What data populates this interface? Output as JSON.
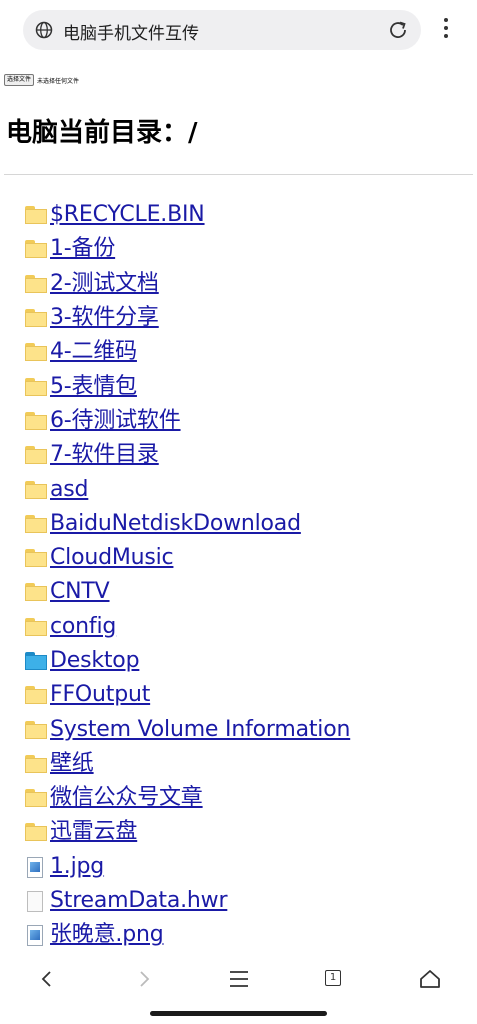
{
  "browser": {
    "url_title": "电脑手机文件互传",
    "tab_count": "1"
  },
  "upload": {
    "button_label": "选择文件",
    "no_file_text": "未选择任何文件"
  },
  "heading": "电脑当前目录：/",
  "entries": [
    {
      "name": "$RECYCLE.BIN",
      "type": "folder"
    },
    {
      "name": "1-备份",
      "type": "folder"
    },
    {
      "name": "2-测试文档",
      "type": "folder"
    },
    {
      "name": "3-软件分享",
      "type": "folder"
    },
    {
      "name": "4-二维码",
      "type": "folder"
    },
    {
      "name": "5-表情包",
      "type": "folder"
    },
    {
      "name": "6-待测试软件",
      "type": "folder"
    },
    {
      "name": "7-软件目录",
      "type": "folder"
    },
    {
      "name": "asd",
      "type": "folder"
    },
    {
      "name": "BaiduNetdiskDownload",
      "type": "folder"
    },
    {
      "name": "CloudMusic",
      "type": "folder"
    },
    {
      "name": "CNTV",
      "type": "folder"
    },
    {
      "name": "config",
      "type": "folder"
    },
    {
      "name": "Desktop",
      "type": "folder-blue"
    },
    {
      "name": "FFOutput",
      "type": "folder"
    },
    {
      "name": "System Volume Information",
      "type": "folder"
    },
    {
      "name": "壁纸",
      "type": "folder"
    },
    {
      "name": "微信公众号文章",
      "type": "folder"
    },
    {
      "name": "迅雷云盘",
      "type": "folder"
    },
    {
      "name": "1.jpg",
      "type": "image"
    },
    {
      "name": "StreamData.hwr",
      "type": "file"
    },
    {
      "name": "张晚意.png",
      "type": "image"
    }
  ],
  "colors": {
    "link": "#1a1aa6",
    "folder": "#fde38a",
    "folder_desktop": "#3db0e8"
  }
}
